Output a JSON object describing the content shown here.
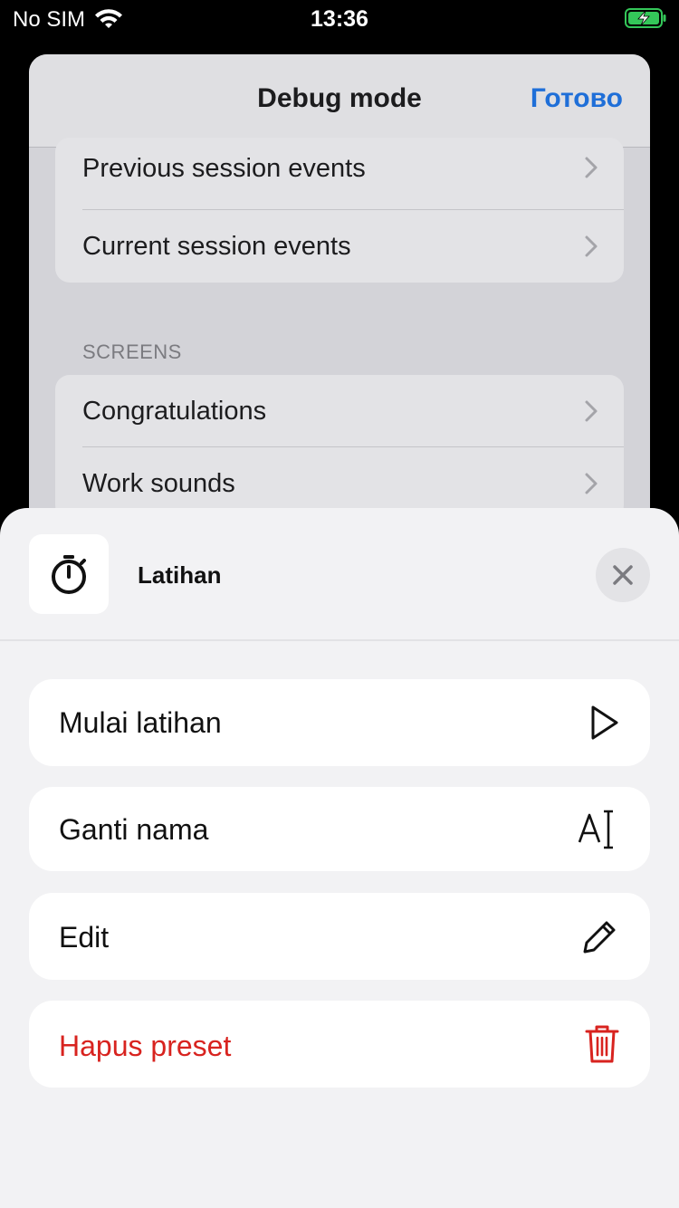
{
  "status_bar": {
    "carrier": "No SIM",
    "time": "13:36",
    "battery_color": "#34c759"
  },
  "background_screen": {
    "title": "Debug mode",
    "done_label": "Готово",
    "accent_color": "#1f6fd8",
    "group1": [
      {
        "label": "Previous session events",
        "icon": "chevron-right-icon"
      },
      {
        "label": "Current session events",
        "icon": "chevron-right-icon"
      }
    ],
    "section_header": "SCREENS",
    "group2": [
      {
        "label": "Congratulations",
        "icon": "chevron-right-icon"
      },
      {
        "label": "Work sounds",
        "icon": "chevron-right-icon"
      }
    ]
  },
  "sheet": {
    "title": "Latihan",
    "app_icon": "stopwatch-icon",
    "close_icon": "close-icon",
    "actions": [
      {
        "label": "Mulai latihan",
        "icon": "play-icon",
        "destructive": false
      },
      {
        "label": "Ganti nama",
        "icon": "rename-text-icon",
        "destructive": false
      },
      {
        "label": "Edit",
        "icon": "pencil-icon",
        "destructive": false
      },
      {
        "label": "Hapus preset",
        "icon": "trash-icon",
        "destructive": true
      }
    ],
    "destructive_color": "#d8231f"
  }
}
